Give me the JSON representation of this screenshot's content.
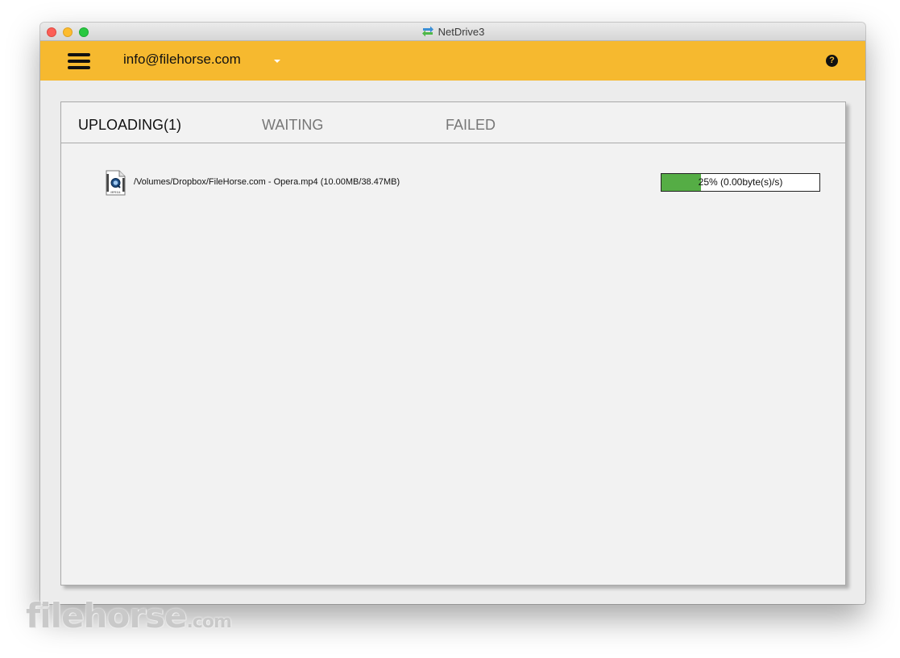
{
  "window": {
    "title": "NetDrive3",
    "app_icon": "netdrive-arrows-icon"
  },
  "header": {
    "account_label": "info@filehorse.com",
    "menu_icon": "hamburger-menu-icon",
    "dropdown_icon": "caret-down-icon",
    "help_label": "?",
    "help_icon": "question-circle-icon",
    "color": "#f6b92f"
  },
  "tabs": [
    {
      "label": "UPLOADING(1)",
      "active": true
    },
    {
      "label": "WAITING",
      "active": false
    },
    {
      "label": "FAILED",
      "active": false
    }
  ],
  "uploads": [
    {
      "path": "/Volumes/Dropbox/FileHorse.com - Opera.mp4 (10.00MB/38.47MB)",
      "file_icon": "mpeg-video-file-icon",
      "file_icon_label": "MPEG4",
      "progress_percent": 25,
      "progress_text": "25% (0.00byte(s)/s)",
      "progress_color": "#55ad45"
    }
  ],
  "watermark": {
    "main": "filehorse",
    "suffix": ".com"
  }
}
